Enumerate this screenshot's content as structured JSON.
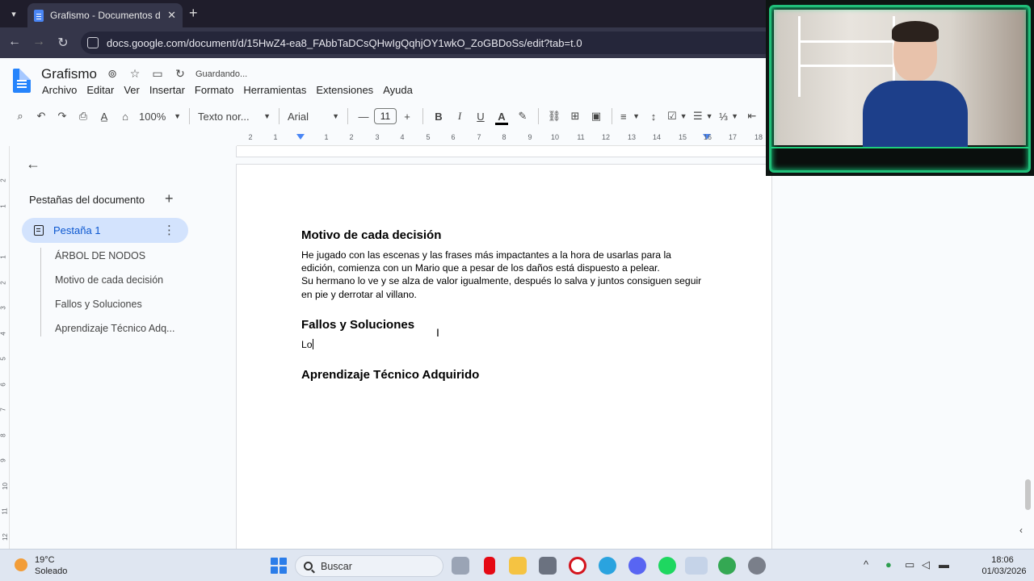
{
  "browser": {
    "tab_title": "Grafismo - Documentos de Google",
    "new_tab": "+",
    "url": "docs.google.com/document/d/15HwZ4-ea8_FAbbTaDCsQHwIgQqhjOY1wkO_ZoGBDoSs/edit?tab=t.0"
  },
  "doc_header": {
    "title": "Grafismo",
    "status": "Guardando...",
    "menu": [
      "Archivo",
      "Editar",
      "Ver",
      "Insertar",
      "Formato",
      "Herramientas",
      "Extensiones",
      "Ayuda"
    ]
  },
  "toolbar": {
    "zoom": "100%",
    "style": "Texto nor...",
    "font": "Arial",
    "font_size": "11"
  },
  "ruler": {
    "labels": [
      "2",
      "1",
      "1",
      "2",
      "3",
      "4",
      "5",
      "6",
      "7",
      "8",
      "9",
      "10",
      "11",
      "12",
      "13",
      "14",
      "15",
      "16",
      "17",
      "18"
    ],
    "vertical_labels": [
      "2",
      "1",
      "1",
      "2",
      "3",
      "4",
      "5",
      "6",
      "7",
      "8",
      "9",
      "10",
      "11",
      "12"
    ]
  },
  "sidebar": {
    "heading": "Pestañas del documento",
    "active_tab": "Pestaña 1",
    "outline": [
      "ÁRBOL DE NODOS",
      "Motivo de cada decisión",
      "Fallos y Soluciones",
      "Aprendizaje Técnico Adq..."
    ]
  },
  "document": {
    "heading1": "Motivo de cada decisión",
    "para1_line1": "He jugado con las escenas y las frases más impactantes a la hora de usarlas para la",
    "para1_line2": "edición, comienza con un Mario que a pesar de los daños está dispuesto a pelear.",
    "para1_line3": "Su hermano lo ve y se alza de valor igualmente, después lo salva y juntos consiguen seguir",
    "para1_line4": "en pie y derrotar al villano.",
    "heading2": "Fallos y Soluciones",
    "para2": "Lo",
    "heading3": "Aprendizaje Técnico Adquirido"
  },
  "taskbar": {
    "weather_temp": "19°C",
    "weather_desc": "Soleado",
    "search_label": "Buscar",
    "time": "18:06",
    "date": "01/03/2026"
  },
  "colors": {
    "accent": "#0b57d0",
    "active_tab_bg": "#d3e3fd",
    "docs_blue": "#2684fc",
    "webcam_frame": "#21c07a"
  },
  "icons": [
    "back-arrow-icon",
    "forward-arrow-icon",
    "reload-icon",
    "site-info-icon",
    "search-icon",
    "undo-icon",
    "redo-icon",
    "print-icon",
    "spellcheck-icon",
    "paint-format-icon",
    "link-icon",
    "comment-icon",
    "image-icon",
    "align-icon",
    "line-spacing-icon",
    "checklist-icon",
    "bullet-list-icon",
    "numbered-list-icon",
    "indent-icon"
  ]
}
